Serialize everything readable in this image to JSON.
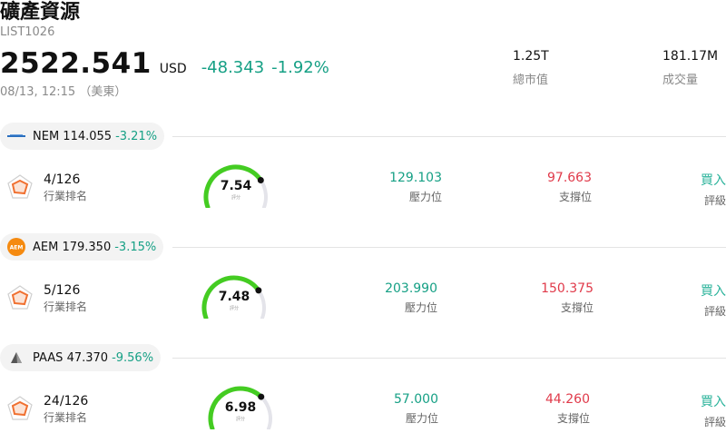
{
  "header": {
    "title": "礦產資源",
    "code": "LIST1026",
    "price": "2522.541",
    "currency": "USD",
    "change": "-48.343",
    "change_pct": "-1.92%",
    "time": "08/13, 12:15 （美東）",
    "market_cap_value": "1.25T",
    "market_cap_label": "總市值",
    "volume_value": "181.17M",
    "volume_label": "成交量"
  },
  "colors": {
    "up": "#16a085",
    "down": "#e03a4a",
    "gauge": "#44cc22",
    "rating": "#2bb39b"
  },
  "stocks": [
    {
      "ticker": "NEM",
      "price": "114.055",
      "change_pct": "-3.21%",
      "logo": "newmont-logo",
      "rank": "4/126",
      "rank_label": "行業排名",
      "score": "7.54",
      "score_label": "評分",
      "score_fraction": 0.754,
      "resistance": "129.103",
      "resistance_label": "壓力位",
      "support": "97.663",
      "support_label": "支撐位",
      "rating": "買入",
      "rating_label": "評級"
    },
    {
      "ticker": "AEM",
      "price": "179.350",
      "change_pct": "-3.15%",
      "logo": "aem-logo",
      "logo_text": "AEM",
      "rank": "5/126",
      "rank_label": "行業排名",
      "score": "7.48",
      "score_label": "評分",
      "score_fraction": 0.748,
      "resistance": "203.990",
      "resistance_label": "壓力位",
      "support": "150.375",
      "support_label": "支撐位",
      "rating": "買入",
      "rating_label": "評級"
    },
    {
      "ticker": "PAAS",
      "price": "47.370",
      "change_pct": "-9.56%",
      "logo": "paas-logo",
      "rank": "24/126",
      "rank_label": "行業排名",
      "score": "6.98",
      "score_label": "評分",
      "score_fraction": 0.698,
      "resistance": "57.000",
      "resistance_label": "壓力位",
      "support": "44.260",
      "support_label": "支撐位",
      "rating": "買入",
      "rating_label": "評級"
    }
  ]
}
